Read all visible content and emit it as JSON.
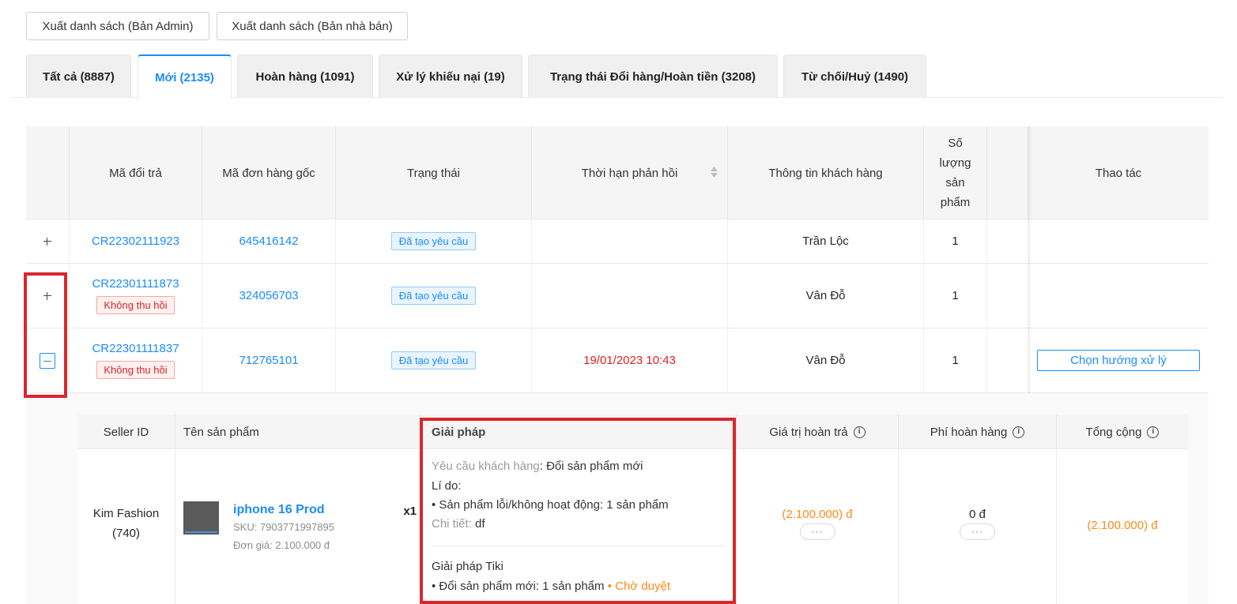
{
  "export_buttons": {
    "admin": "Xuất danh sách (Bản Admin)",
    "seller": "Xuất danh sách (Bản nhà bán)"
  },
  "tabs": [
    {
      "label": "Tất cả (8887)"
    },
    {
      "label": "Mới (2135)"
    },
    {
      "label": "Hoàn hàng (1091)"
    },
    {
      "label": "Xử lý khiếu nại (19)"
    },
    {
      "label": "Trạng thái Đổi hàng/Hoàn tiền (3208)"
    },
    {
      "label": "Từ chối/Huỷ (1490)"
    }
  ],
  "active_tab": "Mới (2135)",
  "table": {
    "headers": {
      "return_code": "Mã đổi trả",
      "order_code": "Mã đơn hàng gốc",
      "status": "Trạng thái",
      "deadline": "Thời hạn phản hồi",
      "customer": "Thông tin khách hàng",
      "quantity": "Số lượng sản phẩm",
      "actions": "Thao tác"
    },
    "rows": [
      {
        "return_code": "CR22302111923",
        "order_code": "645416142",
        "status": "Đã tạo yêu cầu",
        "deadline": "",
        "customer": "Trần Lộc",
        "quantity": "1",
        "action": ""
      },
      {
        "return_code": "CR22301111873",
        "badge": "Không thu hồi",
        "order_code": "324056703",
        "status": "Đã tạo yêu cầu",
        "deadline": "",
        "customer": "Vân Đỗ",
        "quantity": "1",
        "action": ""
      },
      {
        "return_code": "CR22301111837",
        "badge": "Không thu hồi",
        "order_code": "712765101",
        "status": "Đã tạo yêu cầu",
        "deadline": "19/01/2023 10:43",
        "customer": "Vân Đỗ",
        "quantity": "1",
        "action": "Chọn hướng xử lý"
      }
    ]
  },
  "detail": {
    "headers": {
      "seller_id": "Seller ID",
      "product_name": "Tên sản phẩm",
      "solution": "Giải pháp",
      "refund_value": "Giá trị hoàn trả",
      "return_fee": "Phí hoàn hàng",
      "total": "Tổng cộng"
    },
    "seller": {
      "name": "Kim Fashion",
      "id": "(740)"
    },
    "product": {
      "name": "iphone 16 Prod",
      "sku": "SKU: 7903771997895",
      "unit_price": "Đơn giá: 2.100.000 đ",
      "qty": "x1"
    },
    "solution": {
      "request_label": "Yêu cầu khách hàng",
      "request_value": ": Đổi sản phẩm mới",
      "reason_label": "Lí do:",
      "reason_value": "• Sản phẩm lỗi/không hoạt động: 1 sản phẩm",
      "detail_label": "Chi tiết:",
      "detail_value": " df",
      "tiki_label": "Giải pháp Tiki",
      "tiki_value": "• Đổi sản phẩm mới: 1 sản phẩm",
      "tiki_status": " • Chờ duyệt"
    },
    "refund_value": "(2.100.000) đ",
    "return_fee": "0 đ",
    "total": "(2.100.000) đ",
    "more": "···"
  },
  "colors": {
    "link": "#1a8cff",
    "highlight": "#d9272e",
    "orange": "#fa8c16",
    "danger": "#e02020"
  }
}
